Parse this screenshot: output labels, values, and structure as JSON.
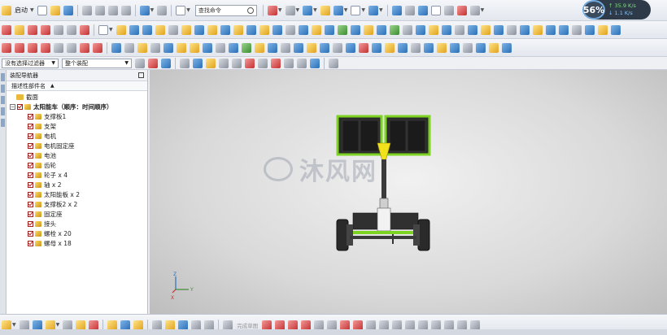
{
  "toolbar": {
    "start_label": "启动",
    "search_placeholder": "查找命令",
    "selection_filter": "没有选择过滤器",
    "assembly_scope": "整个装配"
  },
  "status_badge": {
    "percent": "56%",
    "upload_rate": "↑ 35.9 K/s",
    "download_rate": "↓ 1.1 K/s"
  },
  "navigator": {
    "title": "装配导航器",
    "column_header": "描述性部件名",
    "sort_indicator": "▲",
    "section_label": "截面",
    "root": "太阳能车（顺序：时间顺序）",
    "items": [
      "支撑板1",
      "支架",
      "电机",
      "电机固定座",
      "电池",
      "齿轮",
      "轮子 x 4",
      "轴 x 2",
      "太阳能板 x 2",
      "支撑板2 x 2",
      "固定座",
      "接头",
      "螺栓 x 20",
      "螺母 x 18"
    ]
  },
  "viewport": {
    "watermark": "沐风网",
    "axis_z": "Z",
    "axis_y": "Y",
    "axis_x": "X"
  },
  "bottom_toolbar": {
    "grayed_label": "完成草图"
  },
  "colors": {
    "accent": "#2a6fb8",
    "model_green": "#7dd321",
    "model_yellow": "#f2e21b",
    "checkbox_red": "#c41e1e"
  }
}
